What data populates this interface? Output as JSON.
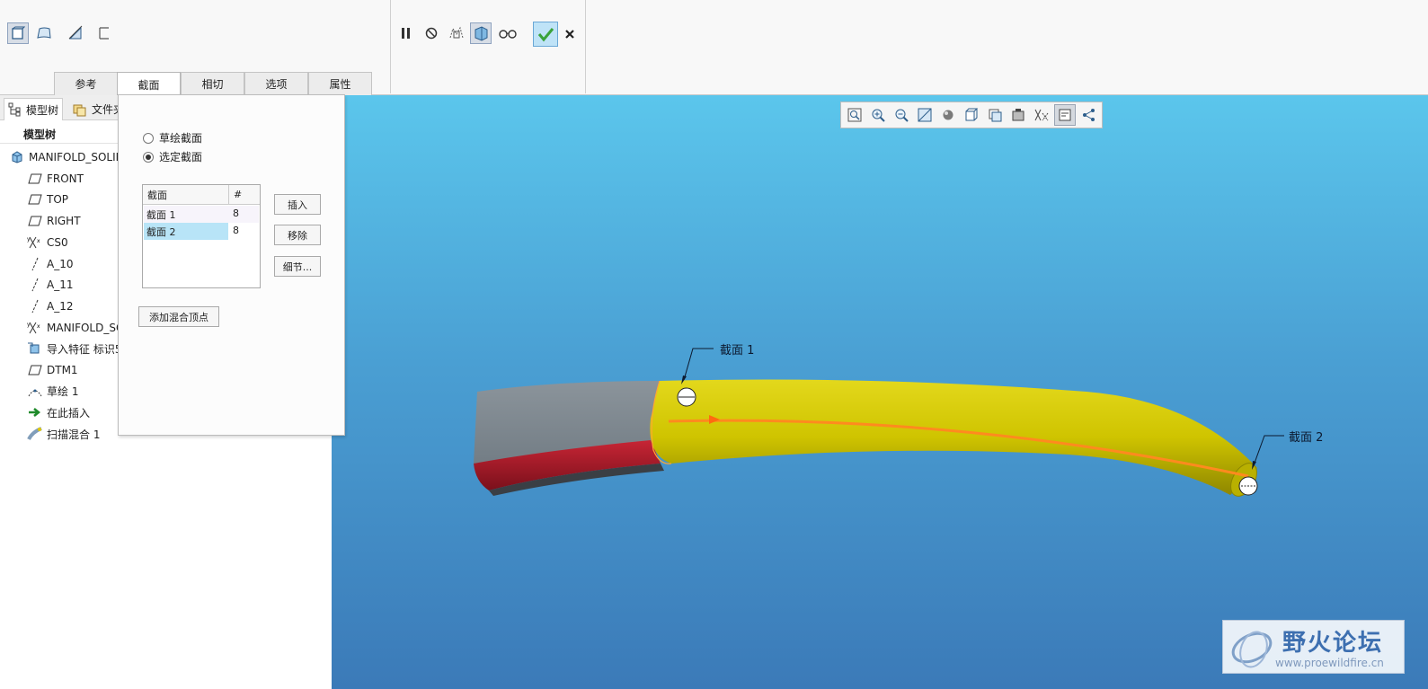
{
  "dashboard": {
    "tabs": [
      {
        "label": "参考"
      },
      {
        "label": "截面"
      },
      {
        "label": "相切"
      },
      {
        "label": "选项"
      },
      {
        "label": "属性"
      }
    ],
    "tools_left": [
      "solid-icon",
      "surface-icon",
      "thicken-icon",
      "remove-material-icon"
    ],
    "tools_right": [
      "pause-icon",
      "no-preview-icon",
      "feature-preview-icon",
      "verify-icon",
      "glasses-icon",
      "ok-icon",
      "cancel-icon"
    ]
  },
  "left_panel": {
    "tabs": [
      {
        "label": "模型树"
      },
      {
        "label": "文件夹"
      }
    ],
    "tree_header": "模型树",
    "tree": [
      {
        "label": "MANIFOLD_SOLID",
        "icon": "part-icon"
      },
      {
        "label": "FRONT",
        "icon": "datum-plane-icon"
      },
      {
        "label": "TOP",
        "icon": "datum-plane-icon"
      },
      {
        "label": "RIGHT",
        "icon": "datum-plane-icon"
      },
      {
        "label": "CS0",
        "icon": "coordinate-system-icon"
      },
      {
        "label": "A_10",
        "icon": "datum-axis-icon"
      },
      {
        "label": "A_11",
        "icon": "datum-axis-icon"
      },
      {
        "label": "A_12",
        "icon": "datum-axis-icon"
      },
      {
        "label": "MANIFOLD_SO",
        "icon": "coordinate-system-icon"
      },
      {
        "label": "导入特征 标识5",
        "icon": "import-feature-icon"
      },
      {
        "label": "DTM1",
        "icon": "datum-plane-icon"
      },
      {
        "label": "草绘 1",
        "icon": "sketch-icon"
      },
      {
        "label": "在此插入",
        "icon": "insert-here-icon"
      },
      {
        "label": "扫描混合 1",
        "icon": "swept-blend-icon"
      }
    ]
  },
  "section_panel": {
    "radio_sketched": "草绘截面",
    "radio_selected": "选定截面",
    "table": {
      "col_section": "截面",
      "col_count": "#",
      "rows": [
        {
          "name": "截面 1",
          "count": "8",
          "selected": false
        },
        {
          "name": "截面 2",
          "count": "8",
          "selected": true
        }
      ]
    },
    "insert_label": "插入",
    "remove_label": "移除",
    "details_label": "细节...",
    "add_vertex_label": "添加混合顶点"
  },
  "viewport": {
    "callout_1": "截面 1",
    "callout_2": "截面 2",
    "watermark_title": "野火论坛",
    "watermark_url": "www.proewildfire.cn"
  },
  "colors": {
    "sweep_yellow": "#cfc400",
    "trajectory_orange": "#ff8a1f",
    "model_grey": "#7f8a92",
    "model_red": "#b21d2c",
    "accept_green": "#3aa33a"
  }
}
